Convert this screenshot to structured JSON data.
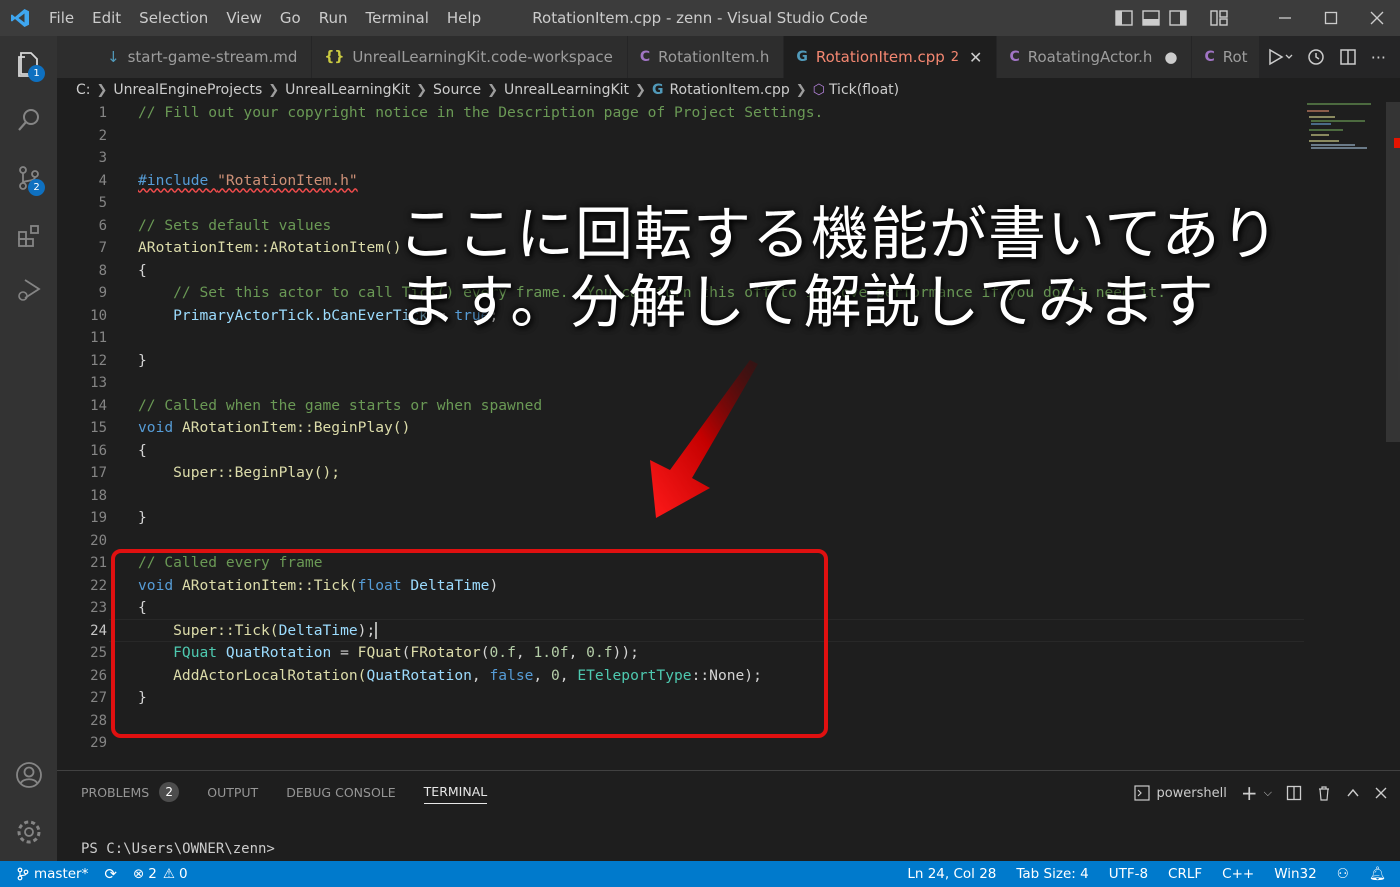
{
  "menu": [
    "File",
    "Edit",
    "Selection",
    "View",
    "Go",
    "Run",
    "Terminal",
    "Help"
  ],
  "window_title": "RotationItem.cpp - zenn - Visual Studio Code",
  "activity": {
    "explorer_badge": "1",
    "scm_badge": "2"
  },
  "tabs": [
    {
      "icon": "",
      "label": "start-game-stream.md",
      "mark": ""
    },
    {
      "icon": "{}",
      "label": "UnrealLearningKit.code-workspace",
      "mark": ""
    },
    {
      "icon": "C",
      "label": "RotationItem.h",
      "mark": ""
    },
    {
      "icon": "G",
      "label": "RotationItem.cpp",
      "mark": "2"
    },
    {
      "icon": "C",
      "label": "RoatatingActor.h",
      "mark": ""
    },
    {
      "icon": "C",
      "label": "Rot",
      "mark": ""
    }
  ],
  "breadcrumb": [
    "C:",
    "UnrealEngineProjects",
    "UnrealLearningKit",
    "Source",
    "UnrealLearningKit",
    "RotationItem.cpp",
    "Tick(float)"
  ],
  "line_numbers": [
    "1",
    "2",
    "3",
    "4",
    "5",
    "6",
    "7",
    "8",
    "9",
    "10",
    "11",
    "12",
    "13",
    "14",
    "15",
    "16",
    "17",
    "18",
    "19",
    "20",
    "21",
    "22",
    "23",
    "24",
    "25",
    "26",
    "27",
    "28",
    "29"
  ],
  "code": {
    "l1": "// Fill out your copyright notice in the Description page of Project Settings.",
    "l4_kw": "#include",
    "l4_str": "\"RotationItem.h\"",
    "l6": "// Sets default values",
    "l7": "ARotationItem::ARotationItem()",
    "l8": "{",
    "l9": "    // Set this actor to call Tick() every frame.  You can turn this off to improve performance if you don't need it.",
    "l10_a": "    PrimaryActorTick.bCanEverTick",
    "l10_b": " = ",
    "l10_c": "true",
    "l10_d": ";",
    "l12": "}",
    "l14": "// Called when the game starts or when spawned",
    "l15_a": "void",
    "l15_b": " ARotationItem::BeginPlay()",
    "l16": "{",
    "l17": "    Super::BeginPlay();",
    "l19": "}",
    "l21": "// Called every frame",
    "l22_a": "void",
    "l22_b": " ARotationItem::Tick(",
    "l22_c": "float",
    "l22_d": " DeltaTime",
    "l22_e": ")",
    "l23": "{",
    "l24_a": "    Super::Tick(",
    "l24_b": "DeltaTime",
    "l24_c": ");",
    "l25_a": "    FQuat ",
    "l25_b": "QuatRotation",
    "l25_c": " = ",
    "l25_d": "FQuat",
    "l25_e": "(",
    "l25_f": "FRotator",
    "l25_g": "(",
    "l25_h": "0.f",
    "l25_i": ", ",
    "l25_j": "1.0f",
    "l25_k": ", ",
    "l25_l": "0.f",
    "l25_m": "));",
    "l26_a": "    AddActorLocalRotation(",
    "l26_b": "QuatRotation",
    "l26_c": ", ",
    "l26_d": "false",
    "l26_e": ", ",
    "l26_f": "0",
    "l26_g": ", ",
    "l26_h": "ETeleportType",
    "l26_i": "::None);",
    "l27": "}"
  },
  "panel": {
    "tabs": [
      "PROBLEMS",
      "OUTPUT",
      "DEBUG CONSOLE",
      "TERMINAL"
    ],
    "problems_count": "2",
    "shell": "powershell",
    "prompt": "PS C:\\Users\\OWNER\\zenn>"
  },
  "status": {
    "branch": "master*",
    "errors": "2",
    "warnings": "0",
    "position": "Ln 24, Col 28",
    "tab_size": "Tab Size: 4",
    "encoding": "UTF-8",
    "eol": "CRLF",
    "language": "C++",
    "platform": "Win32"
  },
  "annotation": {
    "text": "ここに回転する機能が書いてあります。分解して解説してみます"
  },
  "colors": {
    "accent": "#007acc",
    "highlight": "#e01010"
  }
}
